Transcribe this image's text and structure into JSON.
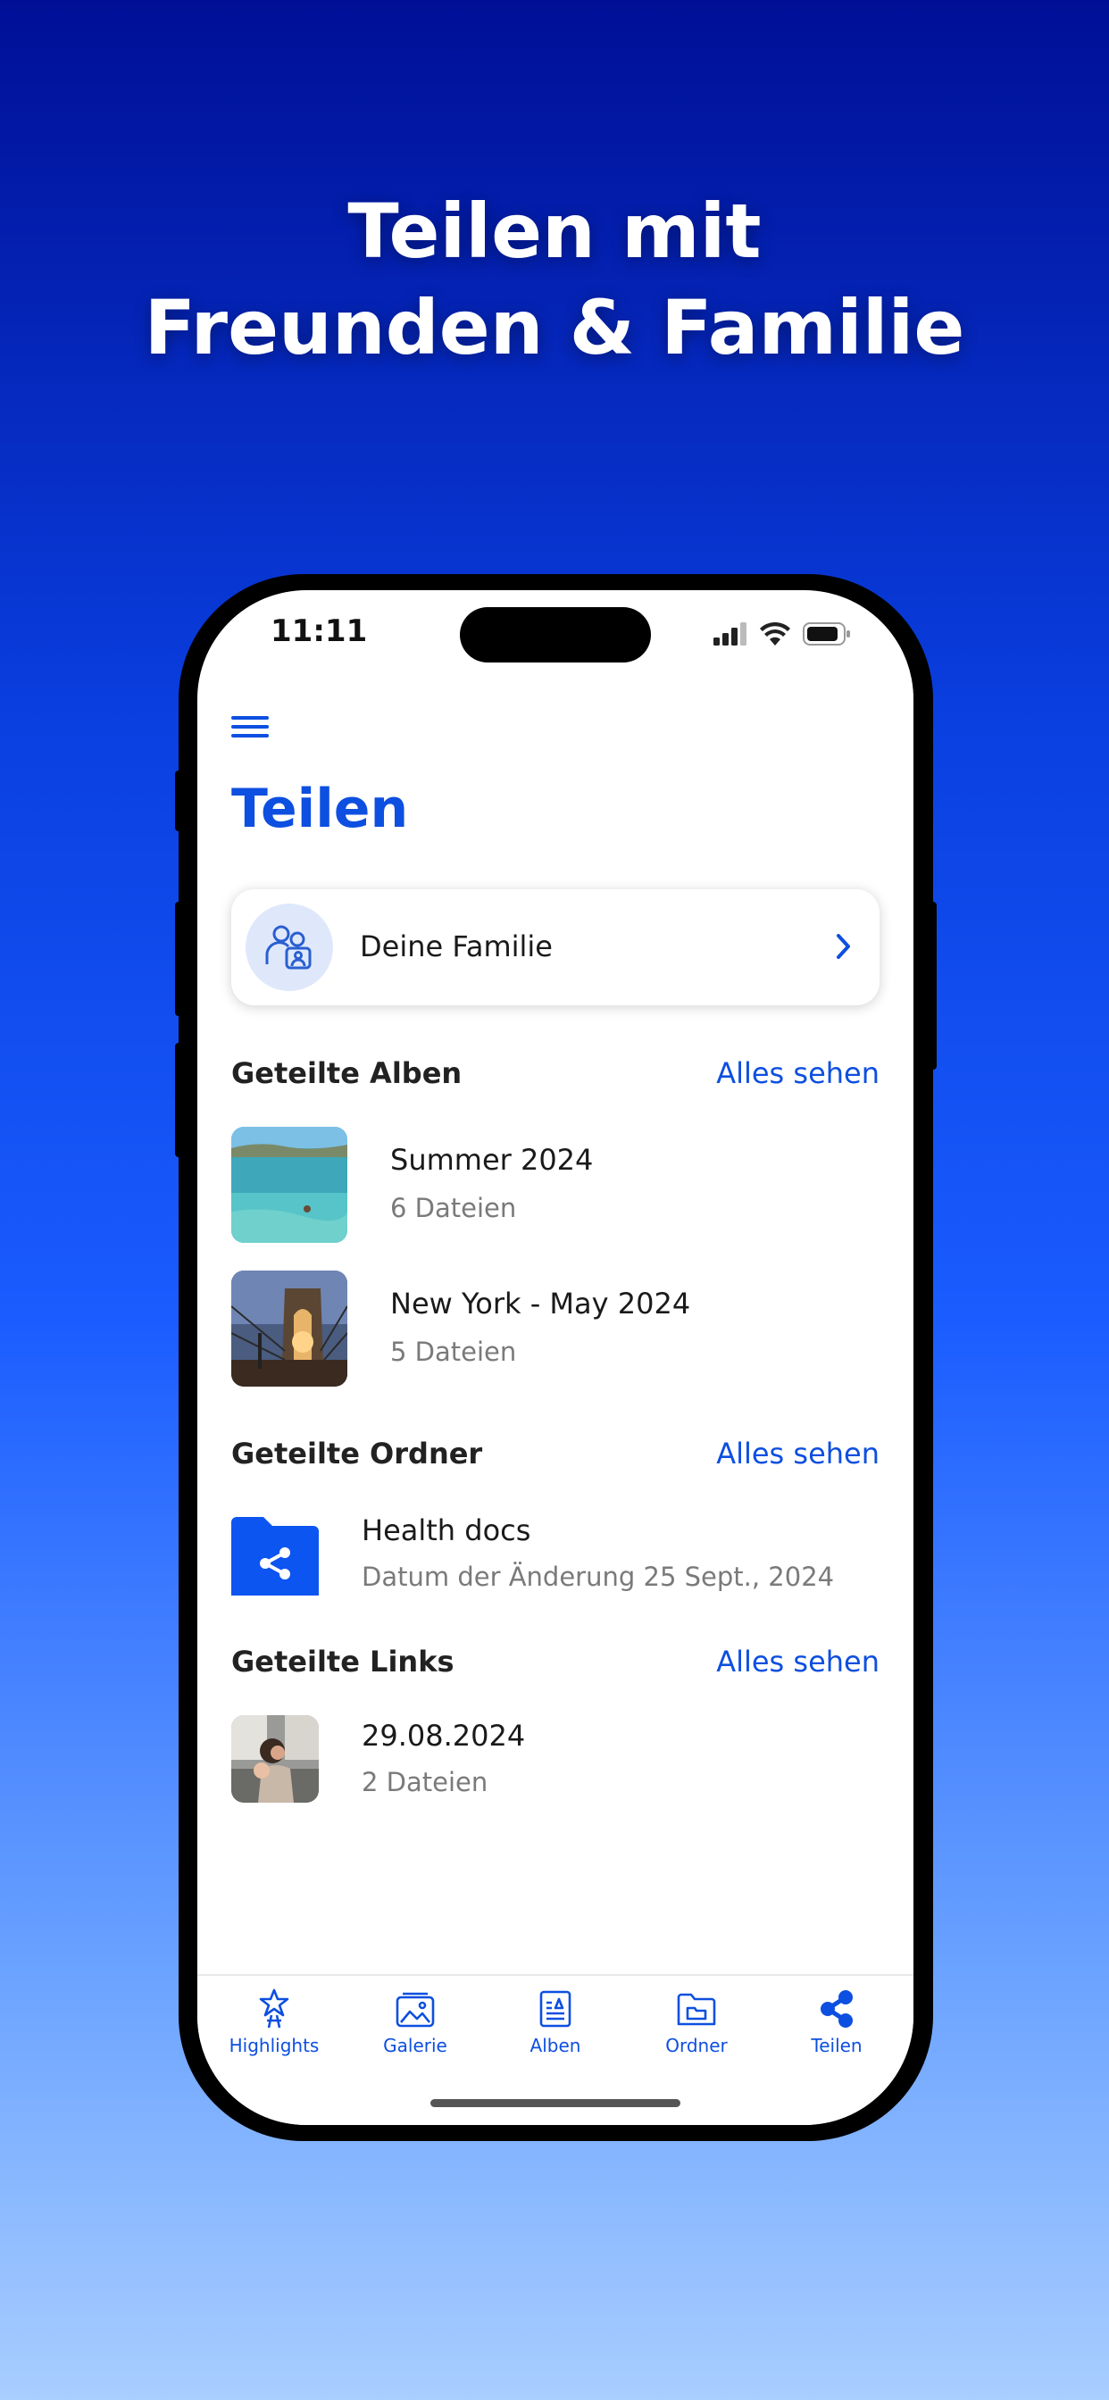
{
  "headline": {
    "line1": "Teilen mit",
    "line2": "Freunden & Familie"
  },
  "status_bar": {
    "time": "11:11",
    "icons": [
      "signal-icon",
      "wifi-icon",
      "battery-icon"
    ]
  },
  "header": {
    "menu_icon": "hamburger-menu-icon",
    "title": "Teilen"
  },
  "family_card": {
    "label": "Deine Familie",
    "icon": "family-icon",
    "chevron": "chevron-right-icon"
  },
  "sections": {
    "albums": {
      "title": "Geteilte Alben",
      "see_all": "Alles sehen",
      "items": [
        {
          "title": "Summer 2024",
          "subtitle": "6 Dateien",
          "thumbnail": "sea-beach-photo"
        },
        {
          "title": "New York - May 2024",
          "subtitle": "5 Dateien",
          "thumbnail": "brooklyn-bridge-photo"
        }
      ]
    },
    "folders": {
      "title": "Geteilte Ordner",
      "see_all": "Alles sehen",
      "items": [
        {
          "title": "Health docs",
          "subtitle": "Datum der Änderung 25 Sept., 2024",
          "icon": "shared-folder-icon"
        }
      ]
    },
    "links": {
      "title": "Geteilte Links",
      "see_all": "Alles sehen",
      "items": [
        {
          "title": "29.08.2024",
          "subtitle": "2 Dateien",
          "thumbnail": "people-photo"
        }
      ]
    }
  },
  "tabbar": {
    "items": [
      {
        "label": "Highlights",
        "icon": "star-person-icon"
      },
      {
        "label": "Galerie",
        "icon": "gallery-icon"
      },
      {
        "label": "Alben",
        "icon": "album-icon"
      },
      {
        "label": "Ordner",
        "icon": "folder-icon"
      },
      {
        "label": "Teilen",
        "icon": "share-icon"
      }
    ]
  },
  "colors": {
    "accent": "#0d4fe0",
    "text": "#1a1a1a",
    "secondary_text": "#7a7a7a"
  }
}
